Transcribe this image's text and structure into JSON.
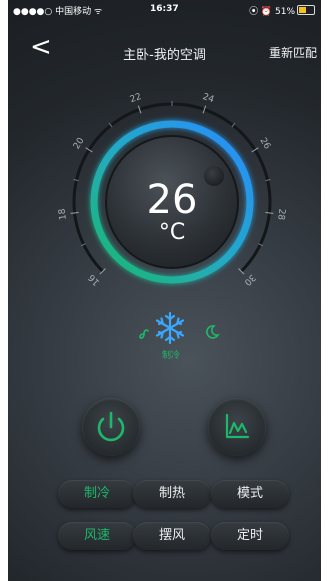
{
  "status_bar": {
    "carrier": "●●●●○ 中国移动 ᯤ",
    "time": "16:37",
    "right": "⦿ ⏰ 51%",
    "battery_level": 0.51
  },
  "nav": {
    "back_label": "<",
    "title": "主卧-我的空调",
    "rematch_label": "重新匹配"
  },
  "dial": {
    "ticks": [
      "16",
      "18",
      "20",
      "22",
      "24",
      "26",
      "28",
      "30"
    ],
    "temperature": "26",
    "unit": "°C",
    "colors": {
      "ring_start": "#1db96a",
      "ring_end": "#2a8bff"
    }
  },
  "mode_indicator": {
    "left_icon": "fan-icon",
    "center_icon": "snowflake-icon",
    "right_icon": "moon-icon",
    "label": "制冷"
  },
  "controls": {
    "power_icon": "power-icon",
    "chart_icon": "chart-icon",
    "accent": "#1db96a"
  },
  "buttons": [
    {
      "label": "制冷",
      "active": true
    },
    {
      "label": "制热",
      "active": false
    },
    {
      "label": "模式",
      "active": false
    },
    {
      "label": "风速",
      "active": true
    },
    {
      "label": "摆风",
      "active": false
    },
    {
      "label": "定时",
      "active": false
    }
  ]
}
